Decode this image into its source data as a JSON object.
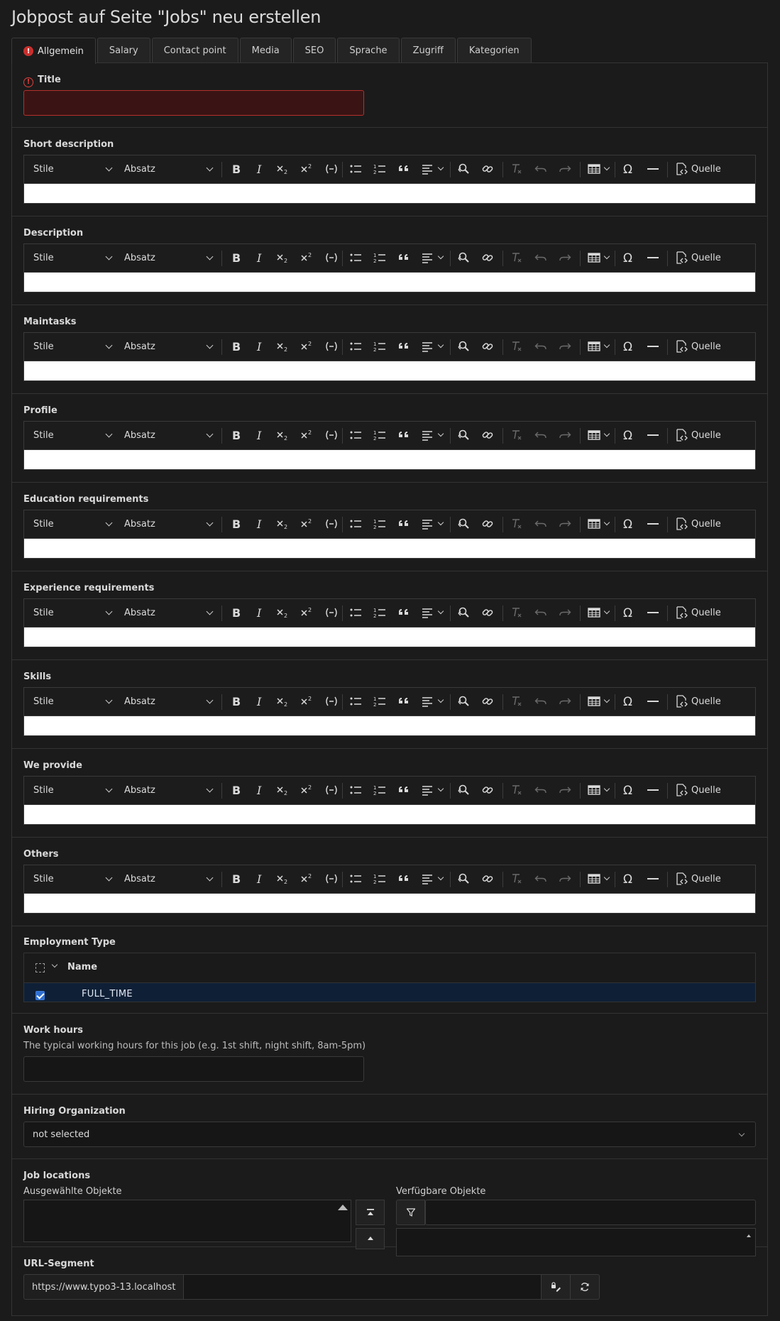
{
  "page": {
    "title": "Jobpost auf Seite \"Jobs\" neu erstellen"
  },
  "tabs": [
    {
      "label": "Allgemein",
      "active": true,
      "error": true
    },
    {
      "label": "Salary"
    },
    {
      "label": "Contact point"
    },
    {
      "label": "Media"
    },
    {
      "label": "SEO"
    },
    {
      "label": "Sprache"
    },
    {
      "label": "Zugriff"
    },
    {
      "label": "Kategorien"
    }
  ],
  "title_field": {
    "label": "Title",
    "value": "",
    "error": true
  },
  "rte_toolbar": {
    "style_select": "Stile",
    "format_select": "Absatz",
    "source_label": "Quelle",
    "icons": [
      "bold-icon",
      "italic-icon",
      "subscript-icon",
      "superscript-icon",
      "soft-hyphen-icon",
      "bulleted-list-icon",
      "numbered-list-icon",
      "blockquote-icon",
      "align-icon",
      "find-replace-icon",
      "link-icon",
      "remove-format-icon",
      "undo-icon",
      "redo-icon",
      "table-icon",
      "special-characters-icon",
      "horizontal-line-icon",
      "source-icon"
    ]
  },
  "rte_fields": [
    {
      "label": "Short description",
      "value": ""
    },
    {
      "label": "Description",
      "value": ""
    },
    {
      "label": "Maintasks",
      "value": ""
    },
    {
      "label": "Profile",
      "value": ""
    },
    {
      "label": "Education requirements",
      "value": ""
    },
    {
      "label": "Experience requirements",
      "value": ""
    },
    {
      "label": "Skills",
      "value": ""
    },
    {
      "label": "We provide",
      "value": ""
    },
    {
      "label": "Others",
      "value": ""
    }
  ],
  "employment_type": {
    "label": "Employment Type",
    "column_header": "Name",
    "rows": [
      {
        "name": "FULL_TIME",
        "checked": true
      }
    ]
  },
  "work_hours": {
    "label": "Work hours",
    "description": "The typical working hours for this job (e.g. 1st shift, night shift, 8am-5pm)",
    "value": ""
  },
  "hiring_organization": {
    "label": "Hiring Organization",
    "selected": "not selected"
  },
  "job_locations": {
    "label": "Job locations",
    "selected_label": "Ausgewählte Objekte",
    "available_label": "Verfügbare Objekte",
    "filter_value": ""
  },
  "url_segment": {
    "label": "URL-Segment",
    "prefix": "https://www.typo3-13.localhost",
    "value": ""
  },
  "colors": {
    "background": "#1b1b1b",
    "error": "#e0413e",
    "error_bg": "#3a1414",
    "selection_bg": "#0f2036",
    "checkbox": "#2f6fd2"
  }
}
